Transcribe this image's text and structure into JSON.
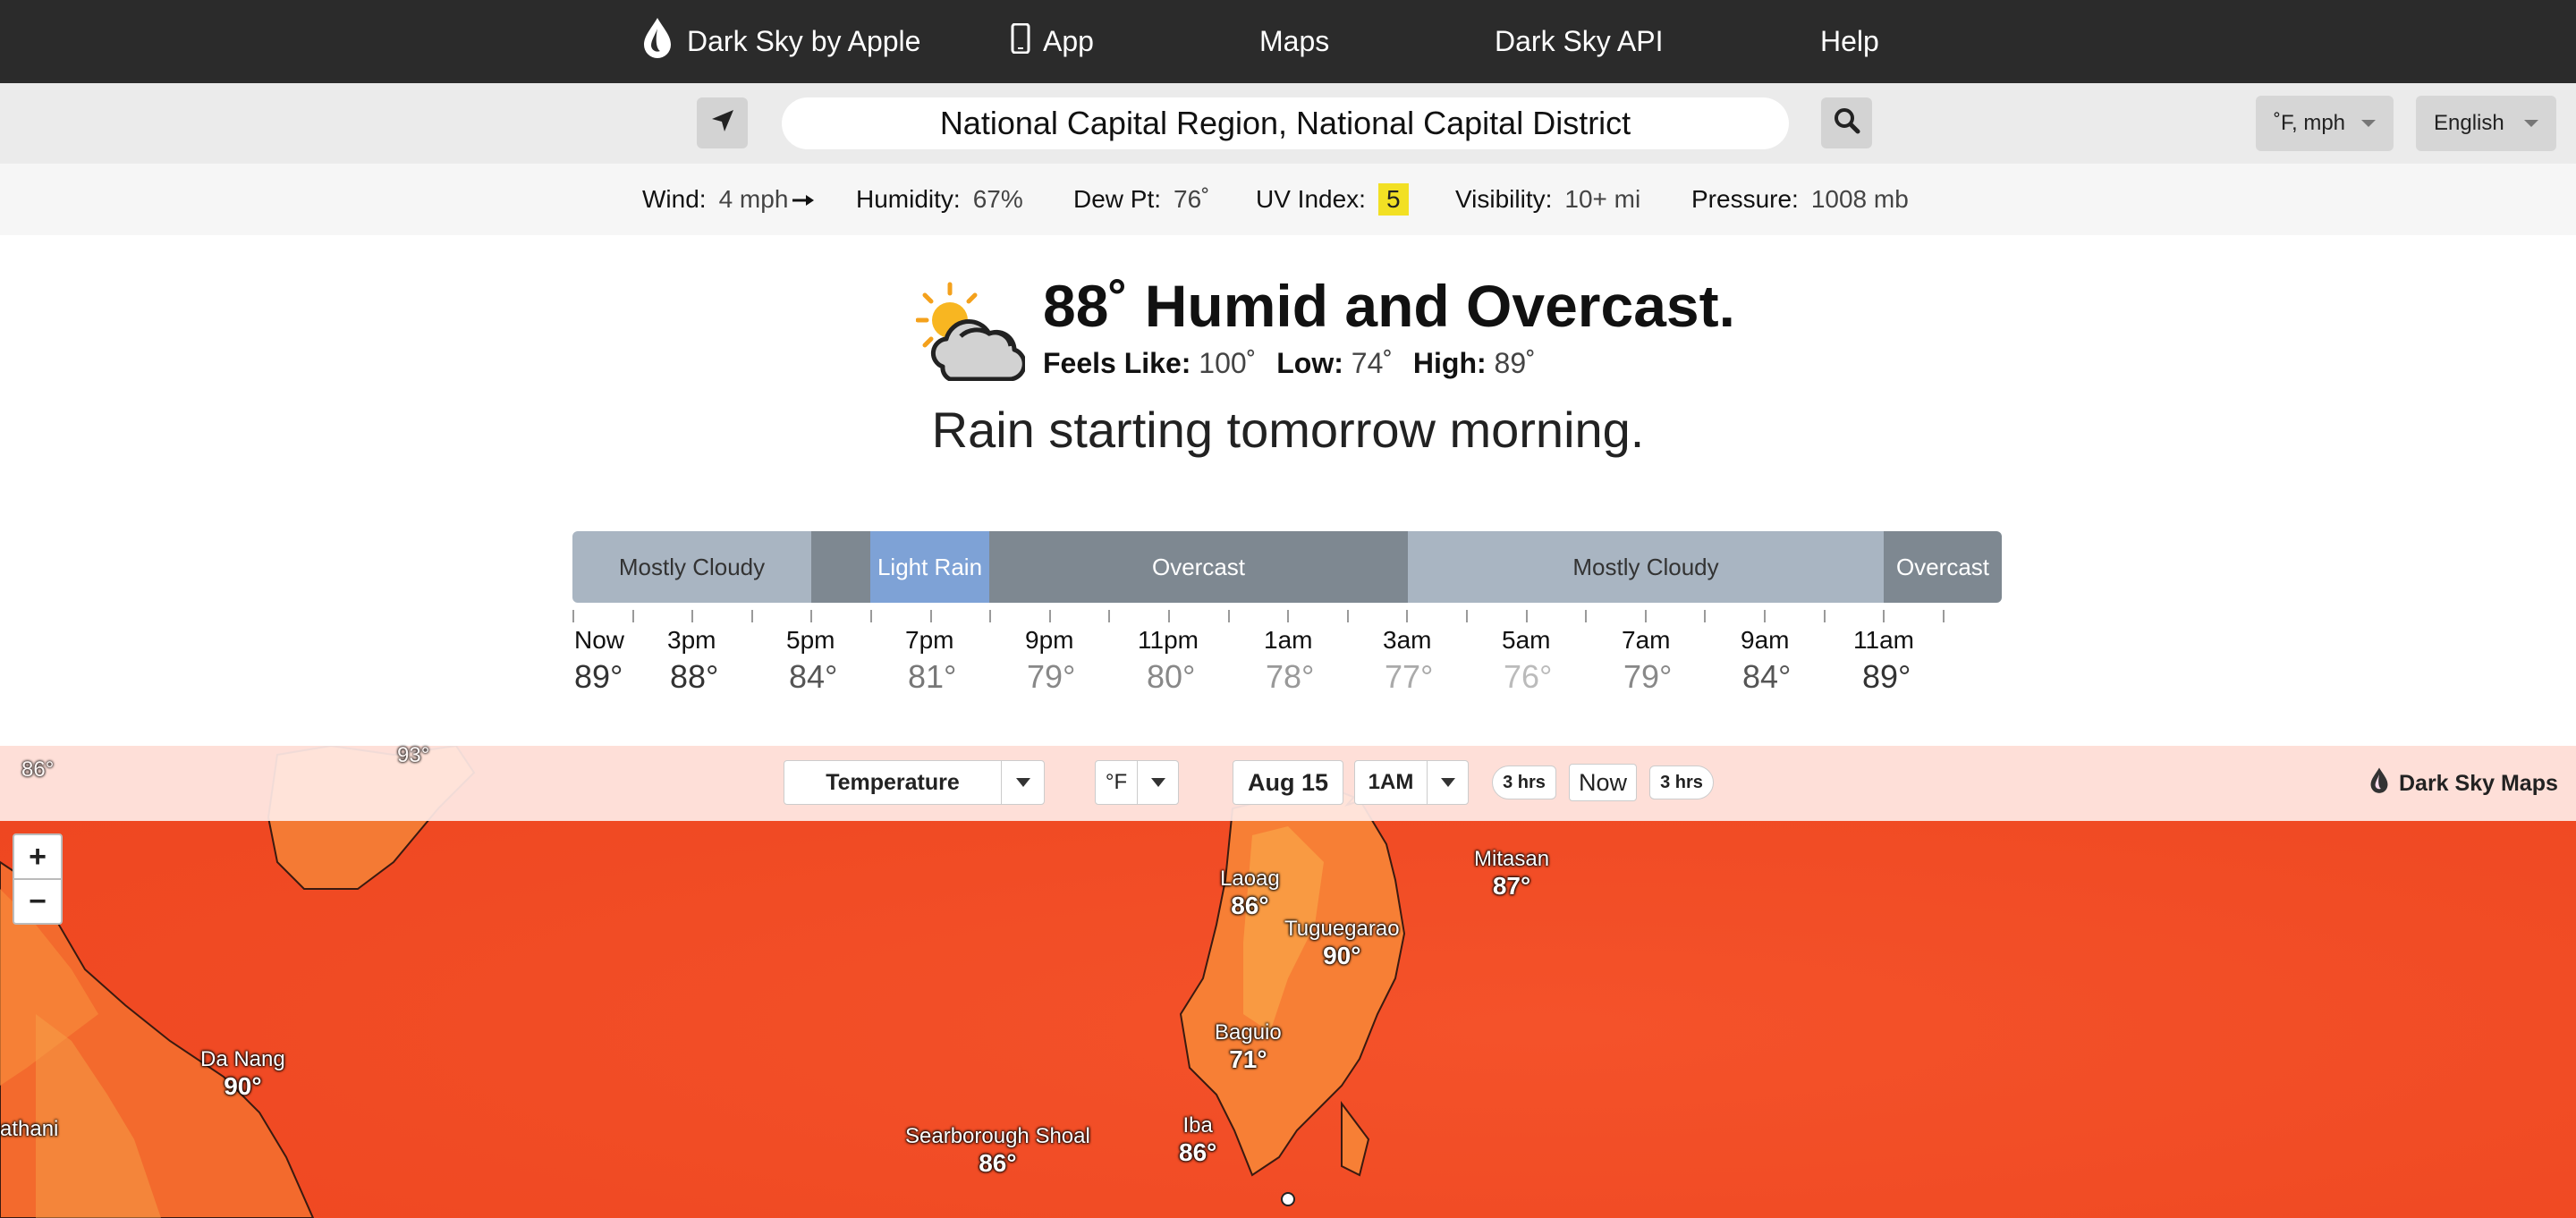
{
  "nav": {
    "brand": "Dark Sky by Apple",
    "app": "App",
    "maps": "Maps",
    "api": "Dark Sky API",
    "help": "Help"
  },
  "search": {
    "location": "National Capital Region, National Capital District",
    "units_label": "˚F, mph",
    "language_label": "English"
  },
  "conditions": {
    "wind_label": "Wind:",
    "wind_value": "4 mph",
    "humidity_label": "Humidity:",
    "humidity_value": "67%",
    "dewpt_label": "Dew Pt:",
    "dewpt_value": "76˚",
    "uv_label": "UV Index:",
    "uv_value": "5",
    "visibility_label": "Visibility:",
    "visibility_value": "10+ mi",
    "pressure_label": "Pressure:",
    "pressure_value": "1008 mb"
  },
  "summary": {
    "headline": "88˚ Humid and Overcast.",
    "feels_label": "Feels Like:",
    "feels_value": "100˚",
    "low_label": "Low:",
    "low_value": "74˚",
    "high_label": "High:",
    "high_value": "89˚",
    "rain_message": "Rain starting tomorrow morning."
  },
  "timeline": {
    "segments": [
      {
        "label": "Mostly Cloudy",
        "color": "#a9b5c2",
        "text_color": "#333333"
      },
      {
        "label": "",
        "color": "#7e8891",
        "text_color": "#ffffff"
      },
      {
        "label": "Light Rain",
        "color": "#7ea2d6",
        "text_color": "#ffffff"
      },
      {
        "label": "Overcast",
        "color": "#7e8891",
        "text_color": "#ffffff"
      },
      {
        "label": "Mostly Cloudy",
        "color": "#a9b5c2",
        "text_color": "#333333"
      },
      {
        "label": "Overcast",
        "color": "#7e8891",
        "text_color": "#ffffff"
      }
    ],
    "hours": [
      {
        "label": "Now",
        "temp": "89°",
        "temp_color": "#333333"
      },
      {
        "label": "3pm",
        "temp": "88°",
        "temp_color": "#333333"
      },
      {
        "label": "5pm",
        "temp": "84°",
        "temp_color": "#555555"
      },
      {
        "label": "7pm",
        "temp": "81°",
        "temp_color": "#777777"
      },
      {
        "label": "9pm",
        "temp": "79°",
        "temp_color": "#888888"
      },
      {
        "label": "11pm",
        "temp": "80°",
        "temp_color": "#888888"
      },
      {
        "label": "1am",
        "temp": "78°",
        "temp_color": "#999999"
      },
      {
        "label": "3am",
        "temp": "77°",
        "temp_color": "#aaaaaa"
      },
      {
        "label": "5am",
        "temp": "76°",
        "temp_color": "#bbbbbb"
      },
      {
        "label": "7am",
        "temp": "79°",
        "temp_color": "#888888"
      },
      {
        "label": "9am",
        "temp": "84°",
        "temp_color": "#555555"
      },
      {
        "label": "11am",
        "temp": "89°",
        "temp_color": "#333333"
      }
    ]
  },
  "map": {
    "layer_select": "Temperature",
    "unit_select": "°F",
    "date": "Aug 15",
    "time_select": "1AM",
    "back_step": "3 hrs",
    "now_button": "Now",
    "forward_step": "3 hrs",
    "brand": "Dark Sky Maps",
    "zoom_in": "+",
    "zoom_out": "−",
    "cities": [
      {
        "name": "Laoag",
        "temp": "86°"
      },
      {
        "name": "Mitasan",
        "temp": "87°"
      },
      {
        "name": "Tuguegarao",
        "temp": "90°"
      },
      {
        "name": "Baguio",
        "temp": "71°"
      },
      {
        "name": "Iba",
        "temp": "86°"
      },
      {
        "name": "Searborough Shoal",
        "temp": "86°"
      },
      {
        "name": "Da Nang",
        "temp": "90°"
      },
      {
        "name": "athani",
        "temp": ""
      }
    ],
    "partial_temps": [
      "86°",
      "93°"
    ]
  }
}
